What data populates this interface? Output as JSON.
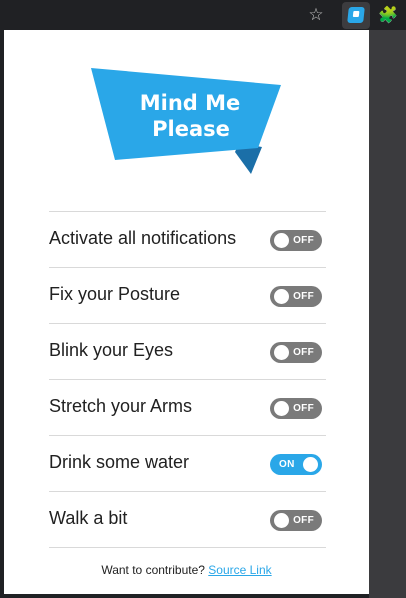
{
  "browser": {
    "star_icon": "star-icon",
    "extension_icon": "mind-me-please-extension-icon",
    "extensions_icon": "puzzle-icon"
  },
  "logo": {
    "line1": "Mind Me",
    "line2": "Please",
    "color": "#2aa7e8"
  },
  "settings": [
    {
      "label": "Activate all notifications",
      "state": "OFF"
    },
    {
      "label": "Fix your Posture",
      "state": "OFF"
    },
    {
      "label": "Blink your Eyes",
      "state": "OFF"
    },
    {
      "label": "Stretch your Arms",
      "state": "OFF"
    },
    {
      "label": "Drink some water",
      "state": "ON"
    },
    {
      "label": "Walk a bit",
      "state": "OFF"
    }
  ],
  "footer": {
    "text": "Want to contribute? ",
    "link": "Source Link"
  },
  "colors": {
    "toggle_on": "#2aa7e8",
    "toggle_off": "#7a7a7a"
  }
}
